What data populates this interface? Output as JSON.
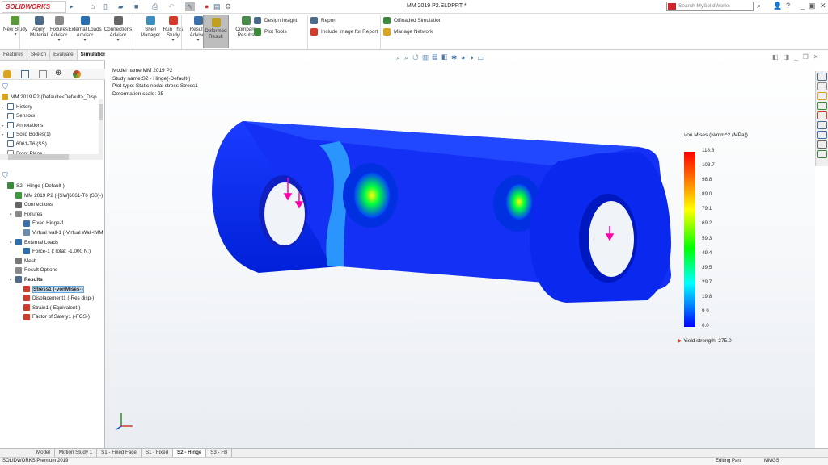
{
  "app": {
    "logo": "SOLIDWORKS",
    "title": "MM 2019 P2.SLDPRT *",
    "search_placeholder": "Search MySolidWorks"
  },
  "ribbon": {
    "buttons": [
      {
        "label": "New Study",
        "icon": "new-study-icon",
        "color": "#5a9a3a"
      },
      {
        "label": "Apply Material",
        "icon": "material-icon",
        "color": "#4a6b8a"
      },
      {
        "label": "Fixtures Advisor",
        "icon": "fixtures-icon",
        "color": "#888888"
      },
      {
        "label": "External Loads Advisor",
        "icon": "loads-icon",
        "color": "#2a6fb0"
      },
      {
        "label": "Connections Advisor",
        "icon": "connections-icon",
        "color": "#666666"
      },
      {
        "label": "Shell Manager",
        "icon": "shell-icon",
        "color": "#3a8fc0"
      },
      {
        "label": "Run This Study",
        "icon": "run-icon",
        "color": "#d23a2a"
      },
      {
        "label": "Results Advisor",
        "icon": "results-icon",
        "color": "#3a6fb0"
      },
      {
        "label": "Deformed Result",
        "icon": "deformed-icon",
        "color": "#c0a020"
      },
      {
        "label": "Compare Results",
        "icon": "compare-icon",
        "color": "#4a8a4a"
      }
    ],
    "small": [
      "Design Insight",
      "Plot Tools",
      "Report",
      "Include Image for Report",
      "Offloaded Simulation",
      "Manage Network"
    ]
  },
  "command_tabs": [
    "Features",
    "Sketch",
    "Evaluate",
    "Simulation"
  ],
  "feature_tree": {
    "root": "MM 2019 P2  (Default<<Default>_Disp",
    "items": [
      "History",
      "Sensors",
      "Annotations",
      "Solid Bodies(1)",
      "6061-T6 (SS)",
      "Front Plane"
    ]
  },
  "study_tree": {
    "items": [
      {
        "label": "S2 - Hinge (-Default-)",
        "indent": 0,
        "color": "#3a8a3a"
      },
      {
        "label": "MM 2019 P2 (-[SW]6061-T6 (SS)-)",
        "indent": 1,
        "color": "#3a9a3a"
      },
      {
        "label": "Connections",
        "indent": 1,
        "color": "#666666"
      },
      {
        "label": "Fixtures",
        "indent": 1,
        "color": "#888888",
        "exp": true
      },
      {
        "label": "Fixed Hinge-1",
        "indent": 2,
        "color": "#3a6fb0"
      },
      {
        "label": "Virtual wall-1 (-Virtual Wall<MM",
        "indent": 2,
        "color": "#6a8ab0"
      },
      {
        "label": "External Loads",
        "indent": 1,
        "color": "#2a6fb0",
        "exp": true
      },
      {
        "label": "Force-1 (:Total: -1,000 N:)",
        "indent": 2,
        "color": "#2a6fb0"
      },
      {
        "label": "Mesh",
        "indent": 1,
        "color": "#777777"
      },
      {
        "label": "Result Options",
        "indent": 1,
        "color": "#888888"
      },
      {
        "label": "Results",
        "indent": 1,
        "color": "#4a6b8a",
        "exp": true,
        "bold": true
      },
      {
        "label": "Stress1 (-vonMises-)",
        "indent": 2,
        "color": "#d23a2a",
        "selected": true
      },
      {
        "label": "Displacement1 (-Res disp-)",
        "indent": 2,
        "color": "#d23a2a"
      },
      {
        "label": "Strain1 (-Equivalent-)",
        "indent": 2,
        "color": "#d23a2a"
      },
      {
        "label": "Factor of Safety1 (-FOS-)",
        "indent": 2,
        "color": "#d23a2a"
      }
    ]
  },
  "plot_info": [
    "Model name:MM 2019 P2",
    "Study name:S2 - Hinge(-Default-)",
    "Plot type: Static nodal stress Stress1",
    "Deformation scale: 25"
  ],
  "legend": {
    "title": "von Mises (N/mm^2 (MPa))",
    "ticks": [
      "118.6",
      "108.7",
      "98.8",
      "89.0",
      "79.1",
      "69.2",
      "59.3",
      "49.4",
      "39.5",
      "29.7",
      "19.8",
      "9.9",
      "0.0"
    ],
    "yield": "Yield strength: 275.0"
  },
  "bottom_tabs": [
    {
      "label": "Model"
    },
    {
      "label": "Motion Study 1"
    },
    {
      "label": "S1 - Fixed Face"
    },
    {
      "label": "S1 - Fixed"
    },
    {
      "label": "S2 - Hinge",
      "active": true
    },
    {
      "label": "S3 - FB"
    }
  ],
  "status": {
    "product": "SOLIDWORKS Premium 2019",
    "mode": "Editing Part",
    "units": "MMGS"
  }
}
